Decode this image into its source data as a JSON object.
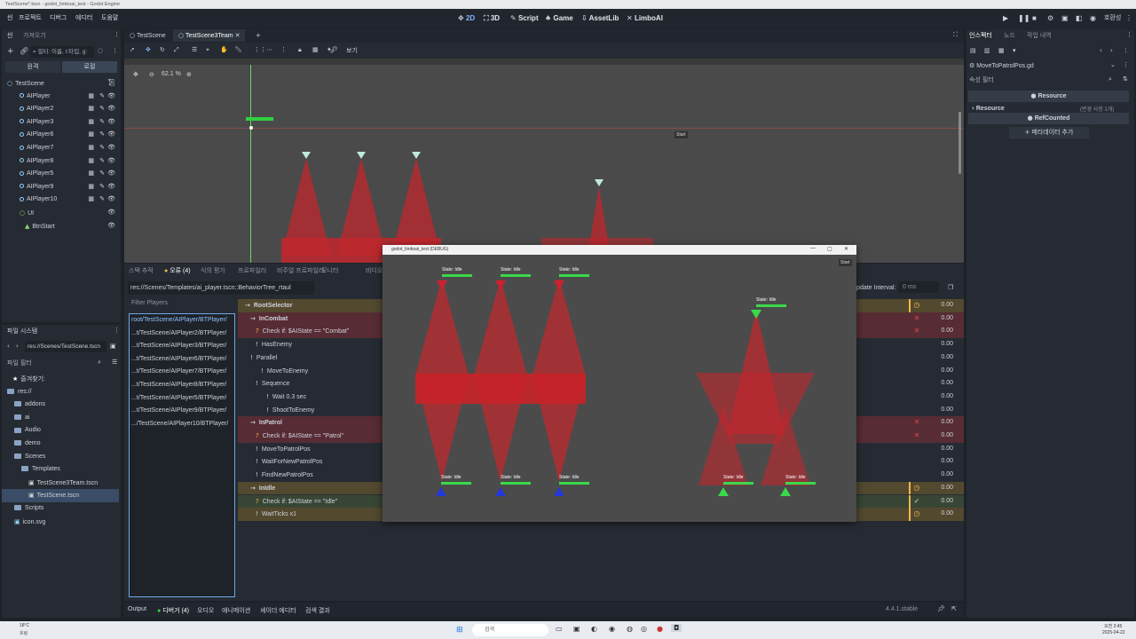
{
  "window": {
    "title": "TestScene*.tscn - godot_limboai_test - Godot Engine"
  },
  "menu": {
    "items": [
      "씬",
      "프로젝트",
      "디버그",
      "에디터",
      "도움말"
    ]
  },
  "workspaces": [
    "2D",
    "3D",
    "Script",
    "Game",
    "AssetLib",
    "LimboAI"
  ],
  "renderer": "호환성",
  "scene_dock": {
    "tabs": [
      "씬",
      "가져오기"
    ],
    "filter_placeholder": "필터: 이름, t:타입, g:",
    "view_tabs": [
      "원격",
      "로컬"
    ],
    "nodes": [
      {
        "label": "TestScene"
      },
      {
        "label": "AIPlayer"
      },
      {
        "label": "AIPlayer2"
      },
      {
        "label": "AIPlayer3"
      },
      {
        "label": "AIPlayer6"
      },
      {
        "label": "AIPlayer7"
      },
      {
        "label": "AIPlayer8"
      },
      {
        "label": "AIPlayer5"
      },
      {
        "label": "AIPlayer9"
      },
      {
        "label": "AIPlayer10"
      },
      {
        "label": "UI"
      },
      {
        "label": "BtnStart"
      }
    ]
  },
  "filesystem": {
    "title": "파일 시스템",
    "path": "res://Scenes/TestScene.tscn",
    "filter_placeholder": "파일 필터",
    "items": [
      {
        "label": "즐겨찾기:"
      },
      {
        "label": "res://"
      },
      {
        "label": "addons"
      },
      {
        "label": "ai"
      },
      {
        "label": "Audio"
      },
      {
        "label": "demo"
      },
      {
        "label": "Scenes"
      },
      {
        "label": "Templates"
      },
      {
        "label": "TestScene3Team.tscn"
      },
      {
        "label": "TestScene.tscn"
      },
      {
        "label": "Scripts"
      },
      {
        "label": "icon.svg"
      }
    ]
  },
  "editor_tabs": [
    "TestScene",
    "TestScene3Team"
  ],
  "toolbar": {
    "view_label": "보기"
  },
  "viewport": {
    "zoom": "62.1 %",
    "start_label": "Start"
  },
  "debugger": {
    "tabs": [
      "스택 추적",
      "오류 (4)",
      "식의 평가",
      "프로파일러",
      "비주얼 프로파일러",
      "모니터",
      "비디오"
    ],
    "bt_path": "res://Scenes/Templates/ai_player.tscn::BehaviorTree_rtaul",
    "update_interval_label": "Update Interval:",
    "update_interval_value": "0 ms",
    "filter_players": "Filter Players",
    "players": [
      "root/TestScene/AIPlayer/BTPlayer/",
      "...t/TestScene/AIPlayer2/BTPlayer/",
      "...t/TestScene/AIPlayer3/BTPlayer/",
      "...t/TestScene/AIPlayer6/BTPlayer/",
      "...t/TestScene/AIPlayer7/BTPlayer/",
      "...t/TestScene/AIPlayer8/BTPlayer/",
      "...t/TestScene/AIPlayer5/BTPlayer/",
      "...t/TestScene/AIPlayer9/BTPlayer/",
      ".../TestScene/AIPlayer10/BTPlayer/"
    ],
    "tasks": [
      {
        "label": "RootSelector",
        "status": "running",
        "time": "0.00",
        "bold": true
      },
      {
        "label": "InCombat",
        "status": "failure",
        "time": "0.00",
        "bold": true
      },
      {
        "label": "Check if: $AIState == \"Combat\"",
        "status": "failure",
        "time": "0.00"
      },
      {
        "label": "HasEnemy",
        "status": "none",
        "time": "0.00"
      },
      {
        "label": "Parallel",
        "status": "none",
        "time": "0.00"
      },
      {
        "label": "MoveToEnemy",
        "status": "none",
        "time": "0.00"
      },
      {
        "label": "Sequence",
        "status": "none",
        "time": "0.00"
      },
      {
        "label": "Wait 0.3 sec",
        "status": "none",
        "time": "0.00"
      },
      {
        "label": "ShootToEnemy",
        "status": "none",
        "time": "0.00"
      },
      {
        "label": "InPatrol",
        "status": "failure",
        "time": "0.00",
        "bold": true
      },
      {
        "label": "Check if: $AIState == \"Patrol\"",
        "status": "failure",
        "time": "0.00"
      },
      {
        "label": "MoveToPatrolPos",
        "status": "none",
        "time": "0.00"
      },
      {
        "label": "WaitForNewPatrolPos",
        "status": "none",
        "time": "0.00"
      },
      {
        "label": "FindNewPatrolPos",
        "status": "none",
        "time": "0.00"
      },
      {
        "label": "InIdle",
        "status": "running",
        "time": "0.00",
        "bold": true
      },
      {
        "label": "Check if: $AIState == \"Idle\"",
        "status": "success",
        "time": "0.00"
      },
      {
        "label": "WaitTicks x1",
        "status": "running",
        "time": "0.00"
      }
    ]
  },
  "bottom_tabs": [
    "Output",
    "디버거 (4)",
    "오디오",
    "애니메이션",
    "셰이더 에디터",
    "검색 결과"
  ],
  "version": "4.4.1.stable",
  "inspector": {
    "tabs": [
      "인스펙터",
      "노드",
      "작업 내역"
    ],
    "resource_name": "MoveToPatrolPos.gd",
    "filter_placeholder": "속성 필터",
    "section_resource": "Resource",
    "resource_row": "Resource",
    "resource_hint": "(변경 사항 1개)",
    "section_refcounted": "RefCounted",
    "add_meta": "메타데이터 추가"
  },
  "game_window": {
    "title": "godot_limboai_test (DEBUG)",
    "start_label": "Start",
    "state_labels": [
      "State: Idle",
      "State: Idle",
      "State: Idle",
      "State: Idle",
      "State: Idle",
      "State: Idle",
      "State: Idle",
      "State: Idle",
      "State: Idle",
      "State: Idle"
    ]
  },
  "taskbar": {
    "weather_temp": "18°C",
    "weather_text": "흐림",
    "search_placeholder": "검색",
    "time": "오전 2:45",
    "date": "2025-04-22"
  },
  "colors": {
    "accent": "#7fb6ff",
    "health": "#3ad94a",
    "vision": "#c0272d",
    "failure": "#e0484e",
    "running": "#f0b84a",
    "success": "#cfe0ad"
  }
}
